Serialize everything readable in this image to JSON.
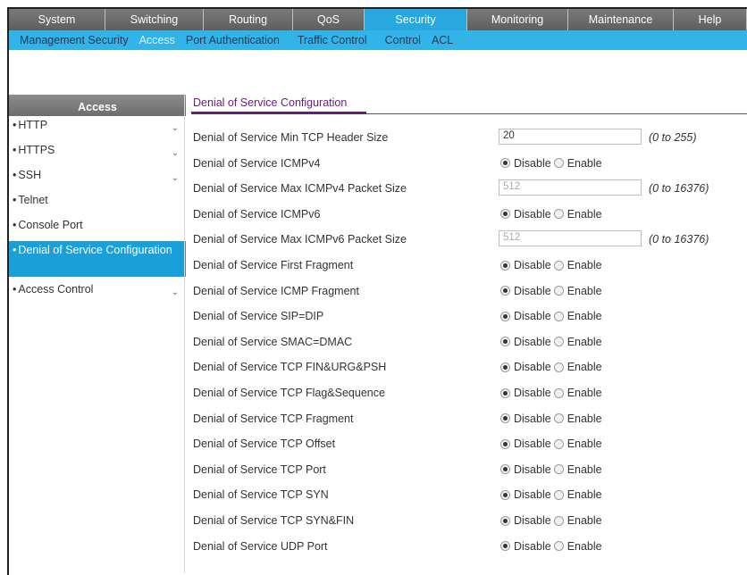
{
  "topnav": {
    "tabs": [
      {
        "label": "System"
      },
      {
        "label": "Switching"
      },
      {
        "label": "Routing"
      },
      {
        "label": "QoS"
      },
      {
        "label": "Security",
        "active": true
      },
      {
        "label": "Monitoring"
      },
      {
        "label": "Maintenance"
      },
      {
        "label": "Help"
      }
    ]
  },
  "subnav": {
    "items": [
      {
        "label": "Management Security"
      },
      {
        "label": "Access",
        "active": true
      },
      {
        "label": "Port Authentication"
      },
      {
        "label": "Traffic Control"
      },
      {
        "label": "Control"
      },
      {
        "label": "ACL"
      }
    ]
  },
  "sidebar": {
    "title": "Access",
    "items": [
      {
        "label": "HTTP",
        "chevron": true
      },
      {
        "label": "HTTPS",
        "chevron": true
      },
      {
        "label": "SSH",
        "chevron": true
      },
      {
        "label": "Telnet"
      },
      {
        "label": "Console Port"
      },
      {
        "label": "Denial of Service Configuration",
        "active": true
      },
      {
        "label": "Access Control",
        "chevron": true
      }
    ]
  },
  "section": {
    "title": "Denial of Service Configuration"
  },
  "radio_labels": {
    "disable": "Disable",
    "enable": "Enable"
  },
  "rows": [
    {
      "label": "Denial of Service Min TCP Header Size",
      "type": "input",
      "value": "20",
      "range": "(0 to 255)"
    },
    {
      "label": "Denial of Service ICMPv4",
      "type": "radio",
      "selected": "disable"
    },
    {
      "label": "Denial of Service Max ICMPv4 Packet Size",
      "type": "input",
      "value": "512",
      "disabled": true,
      "range": "(0 to 16376)"
    },
    {
      "label": "Denial of Service ICMPv6",
      "type": "radio",
      "selected": "disable"
    },
    {
      "label": "Denial of Service Max ICMPv6 Packet Size",
      "type": "input",
      "value": "512",
      "disabled": true,
      "range": "(0 to 16376)"
    },
    {
      "label": "Denial of Service First Fragment",
      "type": "radio",
      "selected": "disable"
    },
    {
      "label": "Denial of Service ICMP Fragment",
      "type": "radio",
      "selected": "disable"
    },
    {
      "label": "Denial of Service SIP=DIP",
      "type": "radio",
      "selected": "disable"
    },
    {
      "label": "Denial of Service SMAC=DMAC",
      "type": "radio",
      "selected": "disable"
    },
    {
      "label": "Denial of Service TCP FIN&URG&PSH",
      "type": "radio",
      "selected": "disable"
    },
    {
      "label": "Denial of Service TCP Flag&Sequence",
      "type": "radio",
      "selected": "disable"
    },
    {
      "label": "Denial of Service TCP Fragment",
      "type": "radio",
      "selected": "disable"
    },
    {
      "label": "Denial of Service TCP Offset",
      "type": "radio",
      "selected": "disable"
    },
    {
      "label": "Denial of Service TCP Port",
      "type": "radio",
      "selected": "disable"
    },
    {
      "label": "Denial of Service TCP SYN",
      "type": "radio",
      "selected": "disable"
    },
    {
      "label": "Denial of Service TCP SYN&FIN",
      "type": "radio",
      "selected": "disable"
    },
    {
      "label": "Denial of Service UDP Port",
      "type": "radio",
      "selected": "disable"
    }
  ]
}
